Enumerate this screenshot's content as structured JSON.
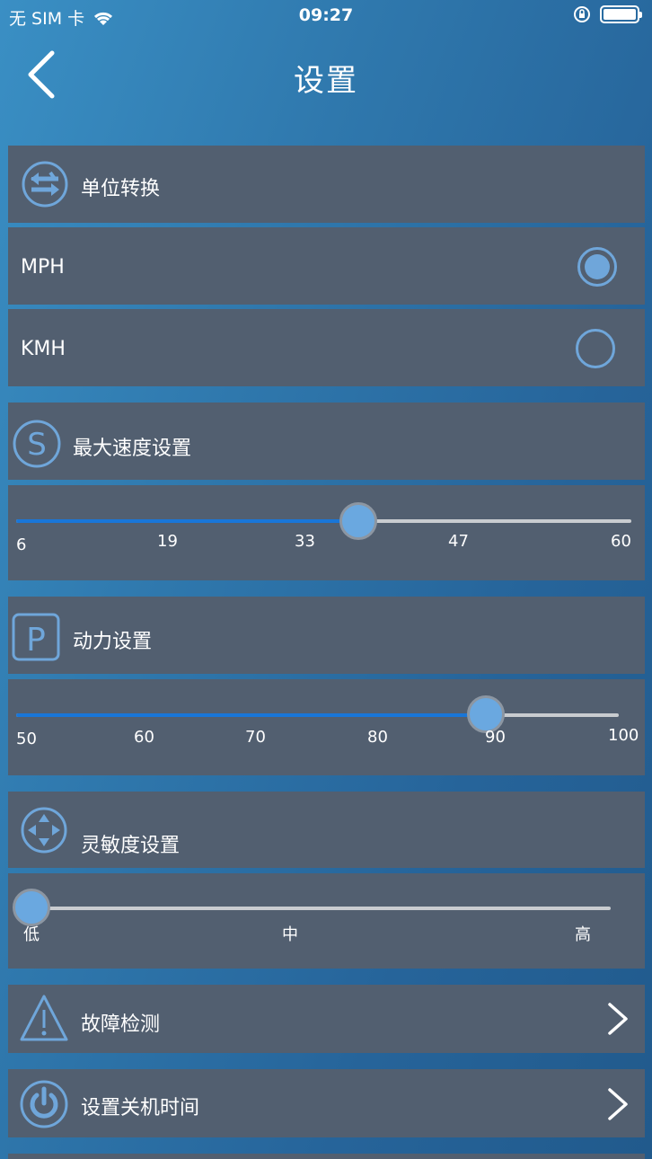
{
  "status_bar": {
    "carrier": "无 SIM 卡",
    "time": "09:27"
  },
  "header": {
    "title": "设置"
  },
  "unit_section": {
    "title": "单位转换",
    "options": [
      {
        "label": "MPH",
        "selected": true
      },
      {
        "label": "KMH",
        "selected": false
      }
    ]
  },
  "max_speed_section": {
    "title": "最大速度设置",
    "ticks": [
      "6",
      "19",
      "33",
      "47",
      "60"
    ],
    "min": 6,
    "max": 60,
    "value": 36
  },
  "power_section": {
    "title": "动力设置",
    "ticks": [
      "50",
      "60",
      "70",
      "80",
      "90",
      "100"
    ],
    "min": 50,
    "max": 100,
    "value": 89
  },
  "sensitivity_section": {
    "title": "灵敏度设置",
    "ticks": [
      "低",
      "中",
      "高"
    ],
    "value_index": 0
  },
  "fault_detection": {
    "label": "故障检测"
  },
  "shutdown_time": {
    "label": "设置关机时间"
  },
  "colors": {
    "accent": "#6fa6da",
    "panel": "#525f70",
    "slider_fill": "#1976d8"
  }
}
